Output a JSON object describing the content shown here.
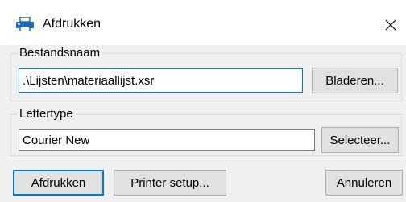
{
  "window": {
    "title": "Afdrukken",
    "icon": "print-app-icon",
    "close_icon": "close-icon"
  },
  "file_group": {
    "label": "Bestandsnaam",
    "file_value": ".\\Lijsten\\materiaallijst.xsr",
    "browse_label": "Bladeren..."
  },
  "font_group": {
    "label": "Lettertype",
    "font_value": "Courier New",
    "select_label": "Selecteer..."
  },
  "actions": {
    "print_label": "Afdrukken",
    "printer_setup_label": "Printer setup...",
    "cancel_label": "Annuleren"
  },
  "colors": {
    "accent": "#0078d7",
    "icon_blue": "#1c6bb0",
    "background": "#f0f0f0"
  }
}
